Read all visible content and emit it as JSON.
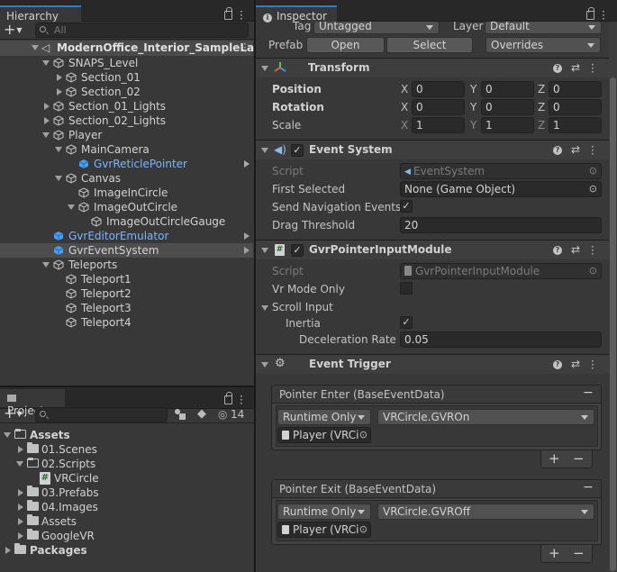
{
  "hierarchy": {
    "tab_label": "Hierarchy",
    "search_placeholder": "All",
    "add_label": "+",
    "scene_name": "ModernOffice_Interior_SampleLay",
    "items": [
      {
        "label": "SNAPS_Level"
      },
      {
        "label": "Section_01"
      },
      {
        "label": "Section_02"
      },
      {
        "label": "Section_01_Lights"
      },
      {
        "label": "Section_02_Lights"
      },
      {
        "label": "Player"
      },
      {
        "label": "MainCamera"
      },
      {
        "label": "GvrReticlePointer"
      },
      {
        "label": "Canvas"
      },
      {
        "label": "ImageInCircle"
      },
      {
        "label": "ImageOutCircle"
      },
      {
        "label": "ImageOutCircleGauge"
      },
      {
        "label": "GvrEditorEmulator"
      },
      {
        "label": "GvrEventSystem"
      },
      {
        "label": "Teleports"
      },
      {
        "label": "Teleport1"
      },
      {
        "label": "Teleport2"
      },
      {
        "label": "Teleport3"
      },
      {
        "label": "Teleport4"
      }
    ]
  },
  "project": {
    "tab_label": "Project",
    "add_label": "+",
    "hidden_count": "14",
    "items": [
      {
        "label": "Assets"
      },
      {
        "label": "01.Scenes"
      },
      {
        "label": "02.Scripts"
      },
      {
        "label": "VRCircle"
      },
      {
        "label": "03.Prefabs"
      },
      {
        "label": "04.Images"
      },
      {
        "label": "Assets"
      },
      {
        "label": "GoogleVR"
      },
      {
        "label": "Packages"
      }
    ]
  },
  "inspector": {
    "tab_label": "Inspector",
    "tag_label": "Tag",
    "tag_value": "Untagged",
    "layer_label": "Layer",
    "layer_value": "Default",
    "prefab_label": "Prefab",
    "open_label": "Open",
    "select_label": "Select",
    "overrides_label": "Overrides",
    "transform": {
      "title": "Transform",
      "position_label": "Position",
      "rotation_label": "Rotation",
      "scale_label": "Scale",
      "x": "X",
      "y": "Y",
      "z": "Z",
      "position": [
        "0",
        "0",
        "0"
      ],
      "rotation": [
        "0",
        "0",
        "0"
      ],
      "scale": [
        "1",
        "1",
        "1"
      ]
    },
    "event_system": {
      "title": "Event System",
      "script_label": "Script",
      "script_value": "EventSystem",
      "first_selected_label": "First Selected",
      "first_selected_value": "None (Game Object)",
      "send_nav_label": "Send Navigation Events",
      "drag_threshold_label": "Drag Threshold",
      "drag_threshold_value": "20"
    },
    "gvr_module": {
      "title": "GvrPointerInputModule",
      "script_label": "Script",
      "script_value": "GvrPointerInputModule",
      "vr_mode_label": "Vr Mode Only",
      "scroll_input_label": "Scroll Input",
      "inertia_label": "Inertia",
      "decel_label": "Deceleration Rate",
      "decel_value": "0.05"
    },
    "event_trigger": {
      "title": "Event Trigger",
      "entries": [
        {
          "header": "Pointer Enter (BaseEventData)",
          "runtime": "Runtime Only",
          "function": "VRCircle.GVROn",
          "target": "Player (VRCi"
        },
        {
          "header": "Pointer Exit (BaseEventData)",
          "runtime": "Runtime Only",
          "function": "VRCircle.GVROff",
          "target": "Player (VRCi"
        }
      ]
    }
  },
  "colors": {
    "accent": "#3a79bb",
    "selected_row": "#4d4d4d",
    "blue_text": "#7bb4ff"
  }
}
